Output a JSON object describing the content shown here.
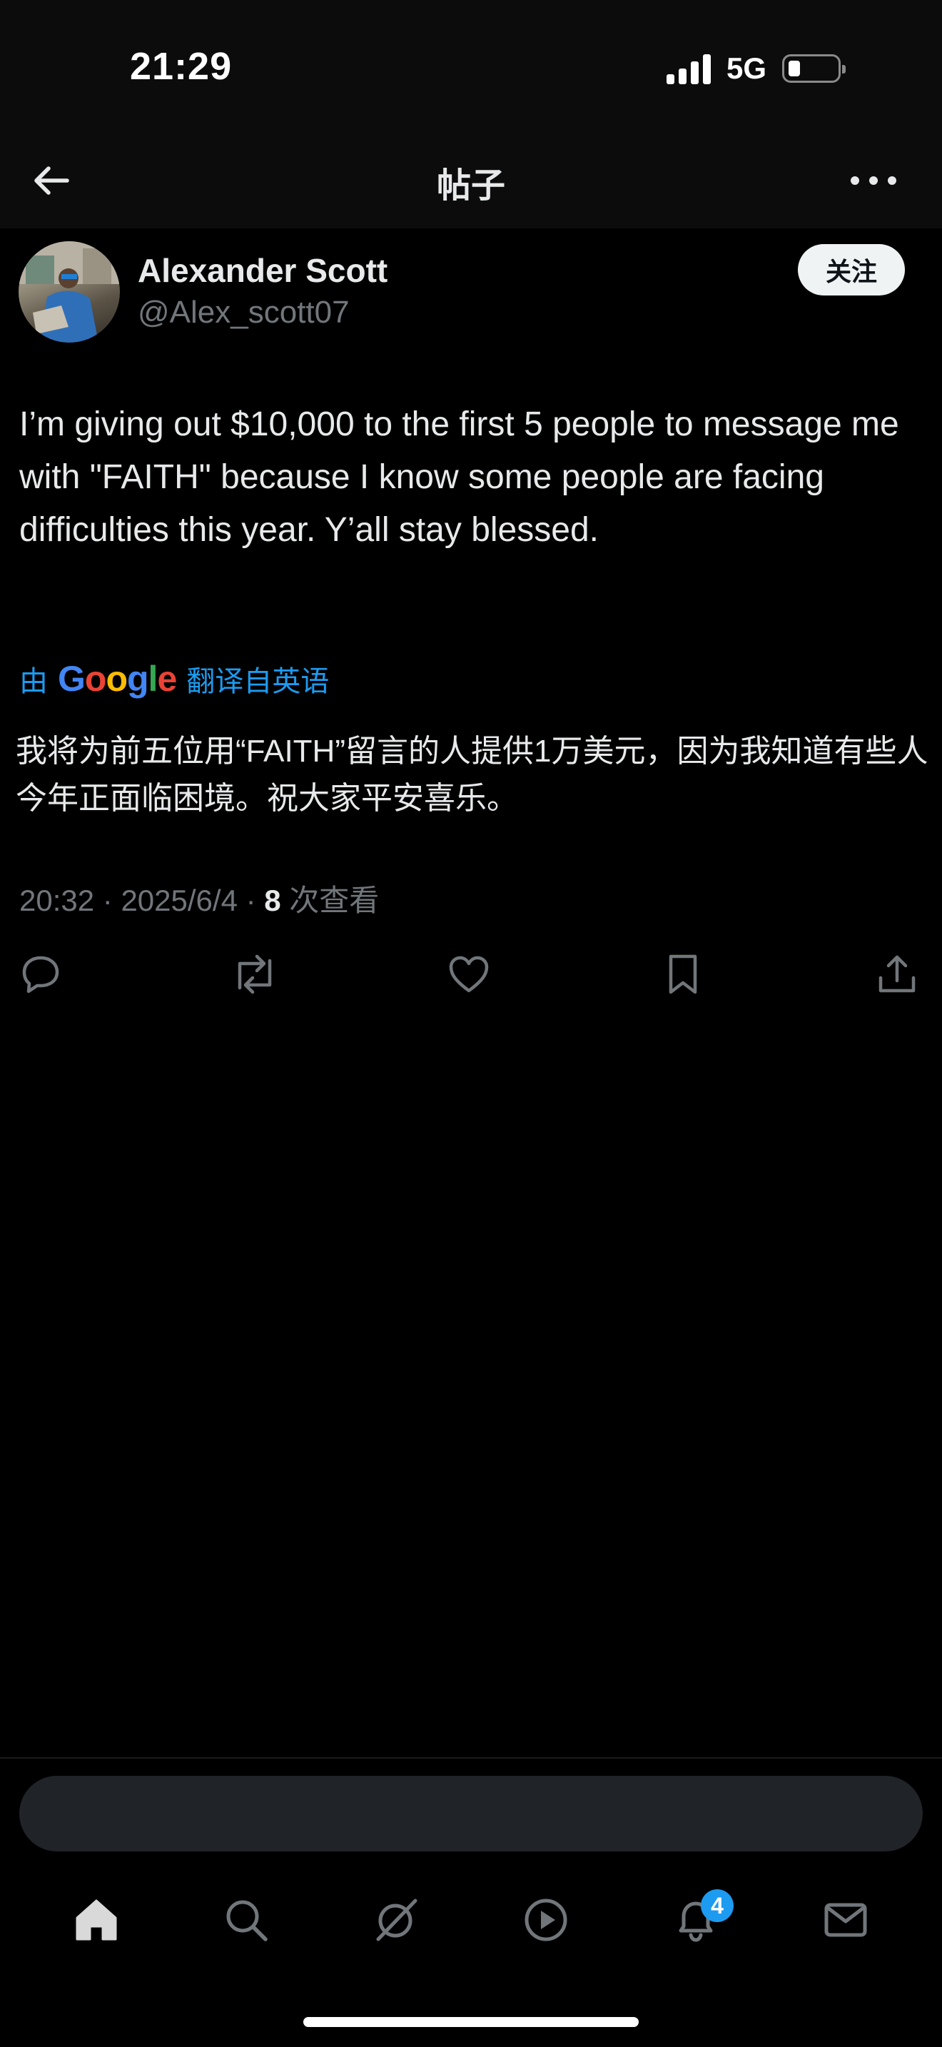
{
  "status_bar": {
    "time": "21:29",
    "network": "5G",
    "battery_level": 0.2
  },
  "header": {
    "title": "帖子"
  },
  "author": {
    "name": "Alexander Scott",
    "handle": "@Alex_scott07",
    "follow_label": "关注"
  },
  "post": {
    "text": "I’m giving out $10,000 to the first 5 people to message me with \"FAITH\" because I know some people are facing difficulties this year. Y’all stay blessed.",
    "translate_prefix": "由",
    "translate_brand": "Google",
    "translate_suffix": "翻译自英语",
    "translated_text": "我将为前五位用“FAITH”留言的人提供1万美元，因为我知道有些人今年正面临困境。祝大家平安喜乐。",
    "time": "20:32",
    "date": "2025/6/4",
    "views_count": "8",
    "views_label": "次查看"
  },
  "actions": [
    "reply-icon",
    "repost-icon",
    "like-icon",
    "bookmark-icon",
    "share-icon"
  ],
  "tab_bar": {
    "tabs": [
      "home-icon",
      "search-icon",
      "grok-icon",
      "video-icon",
      "notifications-icon",
      "messages-icon"
    ],
    "notification_badge": "4"
  },
  "colors": {
    "accent": "#1d9bf0",
    "background": "#000000",
    "muted": "#71767b"
  }
}
